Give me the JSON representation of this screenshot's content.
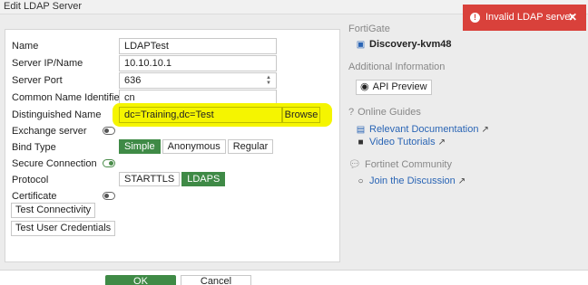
{
  "window": {
    "title": "Edit LDAP Server"
  },
  "form": {
    "name": {
      "label": "Name",
      "value": "LDAPTest"
    },
    "server_ip": {
      "label": "Server IP/Name",
      "value": "10.10.10.1"
    },
    "server_port": {
      "label": "Server Port",
      "value": "636"
    },
    "cn_identifier": {
      "label": "Common Name Identifier",
      "value": "cn"
    },
    "dn": {
      "label": "Distinguished Name",
      "value": "dc=Training,dc=Test",
      "browse_label": "Browse"
    },
    "exchange_server": {
      "label": "Exchange server",
      "enabled": false
    },
    "bind_type": {
      "label": "Bind Type",
      "options": [
        "Simple",
        "Anonymous",
        "Regular"
      ],
      "selected": "Simple"
    },
    "secure_connection": {
      "label": "Secure Connection",
      "enabled": true
    },
    "protocol": {
      "label": "Protocol",
      "options": [
        "STARTTLS",
        "LDAPS"
      ],
      "selected": "LDAPS"
    },
    "certificate": {
      "label": "Certificate",
      "enabled": false
    },
    "test_connectivity_label": "Test Connectivity",
    "test_credentials_label": "Test User Credentials"
  },
  "footer": {
    "ok_label": "OK",
    "cancel_label": "Cancel"
  },
  "sidebar": {
    "fortigate_heading": "FortiGate",
    "device_name": "Discovery-kvm48",
    "additional_heading": "Additional Information",
    "api_preview_label": "API Preview",
    "online_guides_heading": "Online Guides",
    "relevant_docs_label": "Relevant Documentation",
    "video_tutorials_label": "Video Tutorials",
    "community_heading": "Fortinet Community",
    "join_discussion_label": "Join the Discussion"
  },
  "toast": {
    "message": "Invalid LDAP server",
    "color": "#d9413b"
  },
  "colors": {
    "accent_green": "#3f8a46",
    "highlight": "#f5f500",
    "link": "#2a65b5"
  }
}
